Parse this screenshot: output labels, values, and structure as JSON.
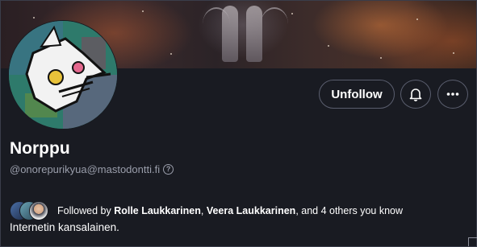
{
  "profile": {
    "display_name": "Norppu",
    "handle": "@onorepurikyua@mastodontti.fi",
    "bio": "Internetin kansalainen."
  },
  "actions": {
    "unfollow_label": "Unfollow",
    "notify_icon": "bell-icon",
    "more_icon": "more-options-icon"
  },
  "followed_by": {
    "prefix": "Followed by ",
    "names": [
      "Rolle Laukkarinen",
      "Veera Laukkarinen"
    ],
    "separator": ", ",
    "suffix": ", and 4 others you know"
  },
  "help_icon_glyph": "?",
  "colors": {
    "background": "#191b22",
    "text": "#ffffff",
    "muted_text": "#9a9eab",
    "button_border": "#5a5e6e"
  }
}
